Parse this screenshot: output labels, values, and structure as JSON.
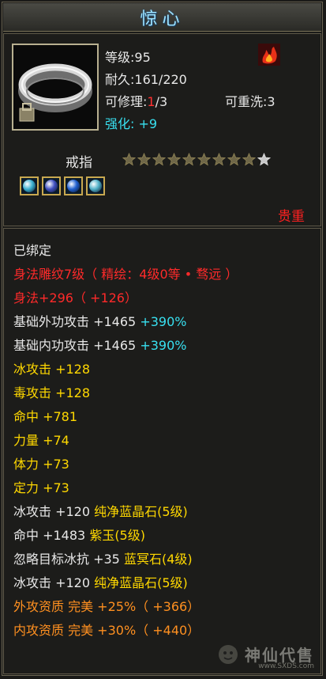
{
  "title": "惊心",
  "stats": {
    "level": "等级:95",
    "durability": "耐久:161/220",
    "repair_label": "可修理:",
    "repair_current": "1",
    "repair_total": "/3",
    "rewash": "可重洗:3",
    "enhance_label": "强化:",
    "enhance_value": "+9"
  },
  "item_type": "戒指",
  "stars": {
    "filled": 9,
    "total": 10
  },
  "gems": [
    "#3ab0d0",
    "#4050c0",
    "#2060d0",
    "#50b0c8"
  ],
  "rarity": "贵重",
  "attributes": [
    {
      "parts": [
        {
          "text": "已绑定",
          "color": "white"
        }
      ]
    },
    {
      "parts": [
        {
          "text": "身法雕纹7级（ 精绘：4级0等 • 骛远 ）",
          "color": "red"
        }
      ]
    },
    {
      "parts": [
        {
          "text": "身法+296（ +126）",
          "color": "red"
        }
      ]
    },
    {
      "parts": [
        {
          "text": "基础外功攻击 +1465 ",
          "color": "white"
        },
        {
          "text": "+390%",
          "color": "cyan"
        }
      ]
    },
    {
      "parts": [
        {
          "text": "基础内功攻击 +1465 ",
          "color": "white"
        },
        {
          "text": "+390%",
          "color": "cyan"
        }
      ]
    },
    {
      "parts": [
        {
          "text": "冰攻击 +128",
          "color": "yellow"
        }
      ]
    },
    {
      "parts": [
        {
          "text": "毒攻击 +128",
          "color": "yellow"
        }
      ]
    },
    {
      "parts": [
        {
          "text": "命中 +781",
          "color": "yellow"
        }
      ]
    },
    {
      "parts": [
        {
          "text": "力量 +74",
          "color": "yellow"
        }
      ]
    },
    {
      "parts": [
        {
          "text": "体力 +73",
          "color": "yellow"
        }
      ]
    },
    {
      "parts": [
        {
          "text": "定力 +73",
          "color": "yellow"
        }
      ]
    },
    {
      "parts": [
        {
          "text": "冰攻击 +120 ",
          "color": "white"
        },
        {
          "text": "纯净蓝晶石(5级)",
          "color": "yellow"
        }
      ]
    },
    {
      "parts": [
        {
          "text": "命中 +1483 ",
          "color": "white"
        },
        {
          "text": "紫玉(5级)",
          "color": "yellow"
        }
      ]
    },
    {
      "parts": [
        {
          "text": "忽略目标冰抗 +35 ",
          "color": "white"
        },
        {
          "text": "蓝冥石(4级)",
          "color": "yellow"
        }
      ]
    },
    {
      "parts": [
        {
          "text": "冰攻击 +120 ",
          "color": "white"
        },
        {
          "text": "纯净蓝晶石(5级)",
          "color": "yellow"
        }
      ]
    },
    {
      "parts": [
        {
          "text": "外攻资质   完美 +25%（ +366）",
          "color": "orange"
        }
      ]
    },
    {
      "parts": [
        {
          "text": "内攻资质   完美 +30%（ +440）",
          "color": "orange"
        }
      ]
    }
  ],
  "watermark": {
    "text": "神仙代售",
    "url": "www.SXDS.com"
  }
}
